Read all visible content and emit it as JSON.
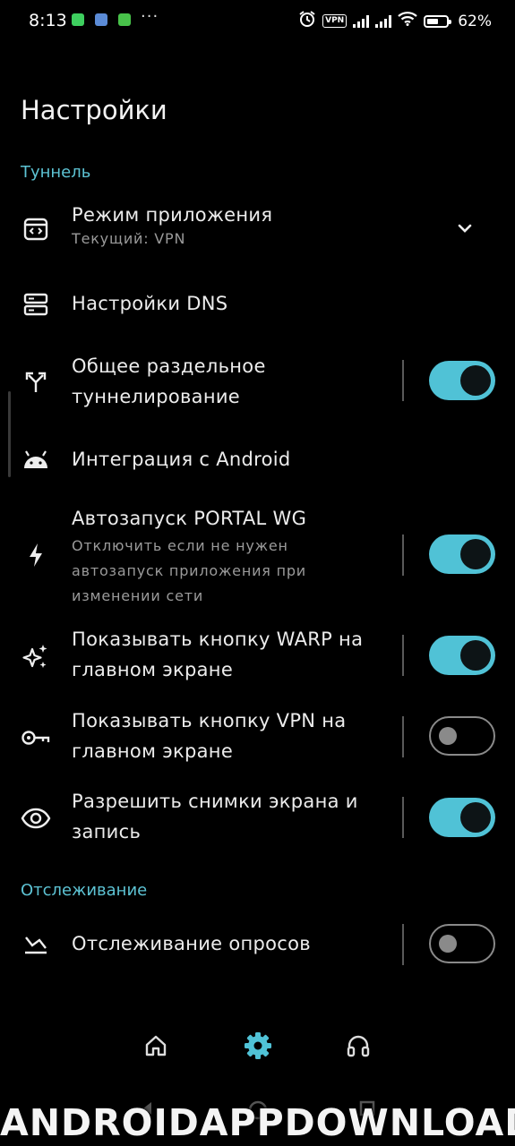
{
  "status_bar": {
    "time": "8:13",
    "dots": "···",
    "vpn_label": "VPN",
    "battery": "62%",
    "battery_level": 0.62,
    "notification_icons": [
      "whatsapp-icon",
      "app-icon",
      "game-icon"
    ],
    "right_icons": [
      "alarm-icon",
      "vpn-icon",
      "signal-icon",
      "signal-icon",
      "wifi-icon",
      "battery-icon"
    ]
  },
  "page": {
    "title": "Настройки"
  },
  "sections": {
    "tunnel": "Туннель",
    "tracking": "Отслеживание"
  },
  "settings": {
    "app_mode": {
      "label": "Режим приложения",
      "sub": "Текущий: VPN",
      "icon": "app-window-icon"
    },
    "dns": {
      "label": "Настройки DNS",
      "icon": "dns-server-icon"
    },
    "split": {
      "label": "Общее раздельное туннелирование",
      "icon": "split-arrows-icon",
      "enabled": true
    },
    "android": {
      "label": "Интеграция с Android",
      "icon": "android-icon"
    },
    "autostart": {
      "label": "Автозапуск PORTAL WG",
      "sub": "Отключить если не нужен автозапуск приложения при изменении сети",
      "icon": "bolt-icon",
      "enabled": true
    },
    "warp": {
      "label": "Показывать кнопку WARP на главном экране",
      "icon": "sparkle-icon",
      "enabled": true
    },
    "vpn_btn": {
      "label": "Показывать кнопку VPN на главном экране",
      "icon": "key-icon",
      "enabled": false
    },
    "screenshots": {
      "label": "Разрешить снимки экрана и запись",
      "icon": "eye-icon",
      "enabled": true
    },
    "polls": {
      "label": "Отслеживание опросов",
      "icon": "poll-tracking-icon",
      "enabled": false
    }
  },
  "bottom_nav": [
    "home-icon",
    "settings-gear-icon",
    "headset-icon"
  ],
  "colors": {
    "accent": "#50c2d6",
    "background": "#000000",
    "toggle_off": "#8a8a8a"
  },
  "watermark": "ANDROIDAPPDOWNLOAD.I"
}
